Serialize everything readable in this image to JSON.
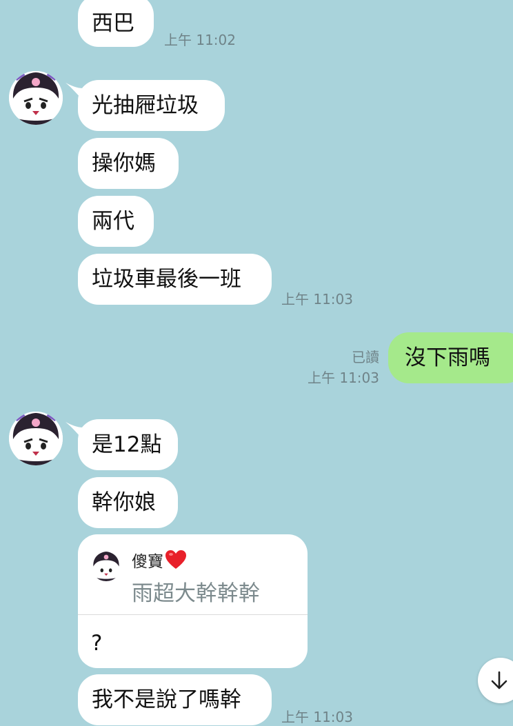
{
  "messages": {
    "m1": "西巴",
    "t1": "上午 11:02",
    "m2": "光抽屜垃圾",
    "m3": "操你媽",
    "m4": "兩代",
    "m5": "垃圾車最後一班",
    "t2": "上午 11:03",
    "out1": "沒下雨嗎",
    "out1_read": "已讀",
    "out1_time": "上午 11:03",
    "m6": "是12點",
    "m7": "幹你娘",
    "m8": "我不是說了嗎幹",
    "t3": "上午 11:03"
  },
  "reply": {
    "name": "傻寶",
    "quote": "雨超大幹幹幹",
    "text": "?"
  },
  "colors": {
    "background": "#a9d3db",
    "incoming_bubble": "#ffffff",
    "outgoing_bubble": "#a5e98b",
    "timestamp": "#6f8388"
  },
  "icons": {
    "avatar": "kuromi-avatar",
    "heart": "red-heart-emoji",
    "scroll": "arrow-down-icon"
  }
}
